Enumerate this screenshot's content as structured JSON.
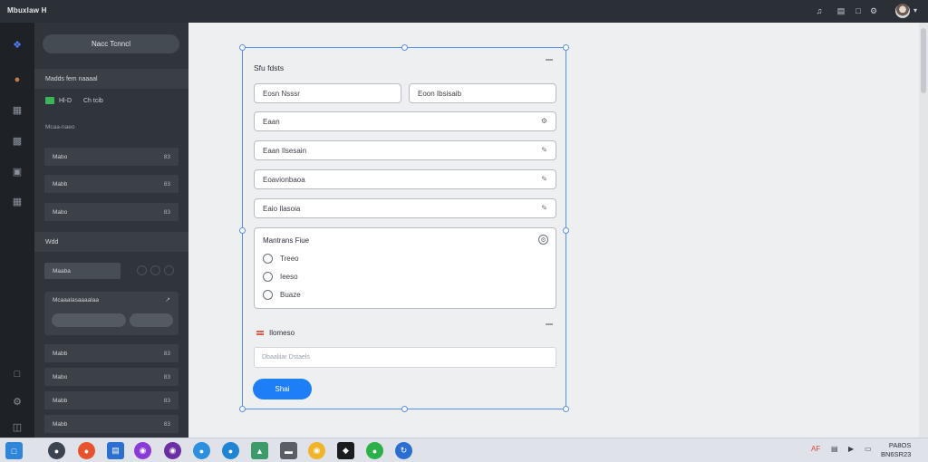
{
  "topbar": {
    "app_title": "Mbuxlaw H",
    "icons": [
      "notification-icon",
      "extensions-icon",
      "settings-icon",
      "user-avatar",
      "chevron-down-icon"
    ]
  },
  "rail": {
    "items": [
      "logo-icon",
      "pages-icon",
      "layers-icon",
      "components-icon",
      "assets-icon",
      "plugins-icon",
      "help-icon",
      "settings-icon",
      "trash-icon"
    ]
  },
  "sidebar": {
    "primary_button": "Nacc Tcnncl",
    "section_header": "Madds fem naaaal",
    "status_text": "Hl-D",
    "status_value": "Ch tcib",
    "group_label": "Mcaa-naeo",
    "rows_a": [
      {
        "label": "Mabo",
        "count": "83"
      },
      {
        "label": "Mabb",
        "count": "83"
      },
      {
        "label": "Mabo",
        "count": "83"
      }
    ],
    "section2": "Wdd",
    "field_value": "Maaba",
    "card_title": "Mcaaalasaaaalaa",
    "rows_b": [
      {
        "label": "Mabb",
        "count": "83"
      },
      {
        "label": "Mabo",
        "count": "83"
      },
      {
        "label": "Mabb",
        "count": "83"
      },
      {
        "label": "Mabb",
        "count": "83"
      }
    ]
  },
  "form": {
    "title": "Sfu fdsts",
    "first_name": "Eosn Nsssr",
    "last_name": "Eoon Ibsisaib",
    "email": "Eaan",
    "field3": "Eaan Ilsesain",
    "field4": "Eoavionbaoa",
    "field5": "Eaio Ilasoia",
    "radio_group": {
      "title": "Mantrans Fiue",
      "options": [
        "Treeo",
        "Ieeso",
        "Buaze"
      ]
    },
    "message_label": "Ilomeso",
    "message_placeholder": "Dbaaliiar Dstaels",
    "submit_label": "Shai"
  },
  "taskbar": {
    "apps": [
      "file-explorer-icon",
      "system-icon",
      "chrome-icon",
      "files-icon",
      "photoshop-icon",
      "media-icon",
      "app-icon",
      "edge-icon",
      "browser-icon",
      "drive-icon",
      "terminal-icon",
      "chrome-icon-2",
      "game-icon",
      "whatsapp-icon",
      "sync-icon"
    ],
    "tray_text": "AF",
    "clock_time": "PA8OS",
    "clock_date": "BN6SR23"
  },
  "colors": {
    "accent": "#1e7ef5",
    "selection": "#5a8fe8",
    "status_green": "#3cb55a",
    "topbar": "#2b2f36",
    "sidebar": "#30353c"
  }
}
